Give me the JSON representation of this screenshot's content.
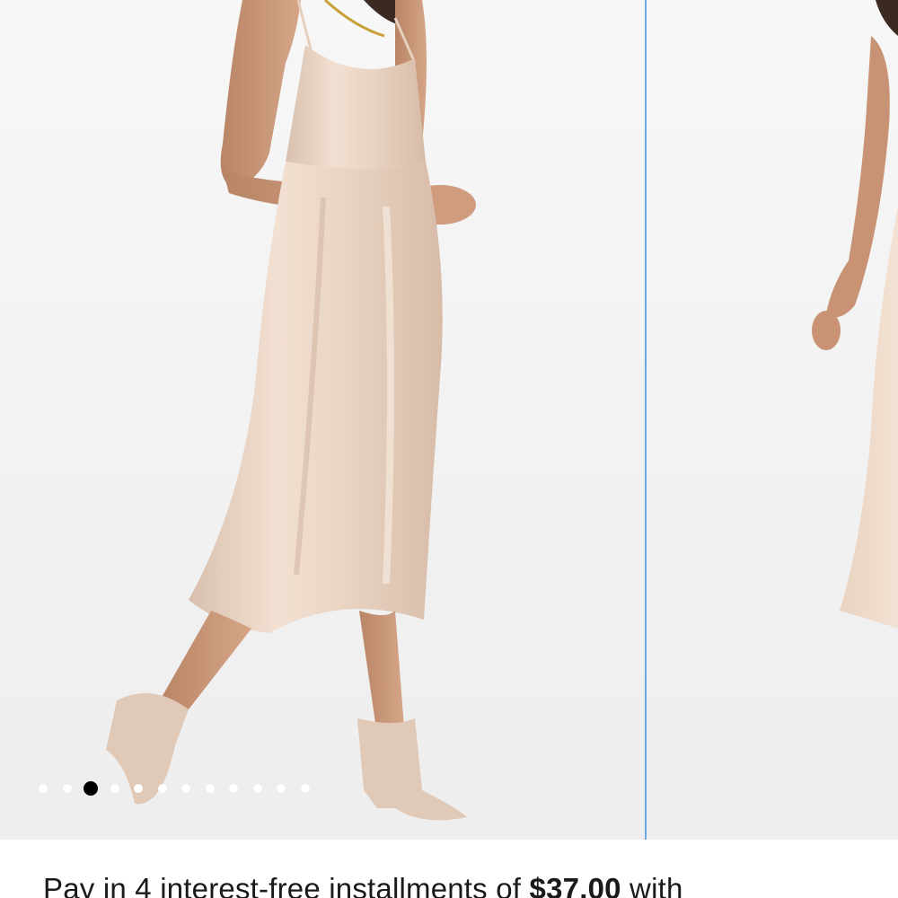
{
  "gallery": {
    "slides": [
      {
        "name": "dress-front-photo",
        "description_icon": "photo"
      },
      {
        "name": "dress-back-photo",
        "description_icon": "photo"
      }
    ],
    "dot_count": 12,
    "active_dot_index": 2,
    "divider_color": "#6aa9e0",
    "dress_color": "#ecd7c6"
  },
  "payment": {
    "prefix": "Pay in 4 interest-free installments of ",
    "price": "$37.00",
    "suffix": " with"
  }
}
